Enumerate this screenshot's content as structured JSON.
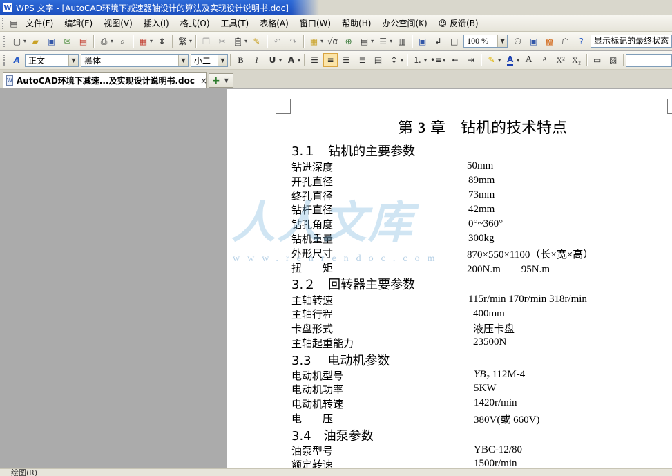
{
  "window": {
    "app_icon": "W",
    "title": "WPS 文字 - [AutoCAD环境下减速器轴设计的算法及实现设计说明书.doc]"
  },
  "menu": {
    "items": [
      "文件(F)",
      "编辑(E)",
      "视图(V)",
      "插入(I)",
      "格式(O)",
      "工具(T)",
      "表格(A)",
      "窗口(W)",
      "帮助(H)",
      "办公空间(K)",
      "反馈(B)"
    ]
  },
  "toolbar1": {
    "traditional_label": "繁",
    "zoom_value": "100 %",
    "markup_display": "显示标记的最终状态"
  },
  "toolbar2": {
    "style_value": "正文",
    "font_value": "黑体",
    "size_value": "小二",
    "bold": "B",
    "italic": "I",
    "underline": "U",
    "char_style": "A",
    "font_color": "A",
    "grow": "A",
    "shrink": "A",
    "superscript": "X²",
    "subscript": "X₂"
  },
  "tabs": {
    "active_label": "AutoCAD环境下减速...及实现设计说明书.doc",
    "close_glyph": "×",
    "new_glyph": "+"
  },
  "document": {
    "chapter_prefix": "第",
    "chapter_num": "3",
    "chapter_suffix": "章　钻机的技术特点",
    "sections": [
      {
        "heading": "3.１　钻机的主要参数",
        "rows": [
          {
            "label": "钻进深度",
            "value": "50mm"
          },
          {
            "label": "开孔直径",
            "value": "89mm"
          },
          {
            "label": "终孔直径",
            "value": "73mm"
          },
          {
            "label": "钻杆直径",
            "value": "42mm"
          },
          {
            "label": "钻孔角度",
            "value": "0°~360°"
          },
          {
            "label": "钻机重量",
            "value": "300kg"
          },
          {
            "label": "外形尺寸",
            "value": "870×550×1100（长×宽×高）"
          },
          {
            "label": "扭　　矩",
            "value": "200N.m　　95N.m"
          }
        ]
      },
      {
        "heading": "3.２　回转器主要参数",
        "rows": [
          {
            "label": "主轴转速",
            "value": "115r/min 170r/min 318r/min"
          },
          {
            "label": "主轴行程",
            "value": "400mm"
          },
          {
            "label": "卡盘形式",
            "value": "液压卡盘"
          },
          {
            "label": "主轴起重能力",
            "value": "23500N"
          }
        ]
      },
      {
        "heading": "3.3　 电动机参数",
        "rows": [
          {
            "label": "电动机型号",
            "value_italic": "YB₂",
            "value": " 112M-4"
          },
          {
            "label": "电动机功率",
            "value": "5KW"
          },
          {
            "label": "电动机转速",
            "value": "1420r/min"
          },
          {
            "label": "电　　压",
            "value": "380V(或 660V)"
          }
        ]
      },
      {
        "heading": "3.4　油泵参数",
        "rows": [
          {
            "label": "油泵型号",
            "value": "YBC-12/80"
          },
          {
            "label": "额定转速",
            "value": "1500r/min"
          }
        ]
      }
    ]
  },
  "watermark": {
    "main": "人人文库",
    "sub": "www.renrendoc.com"
  },
  "bottombar": {
    "draw_label": "绘图(R)"
  },
  "colors": {
    "titlebar": "#1C4FBF",
    "workspace": "#ABABAB",
    "toolbar": "#ECE9D8"
  }
}
